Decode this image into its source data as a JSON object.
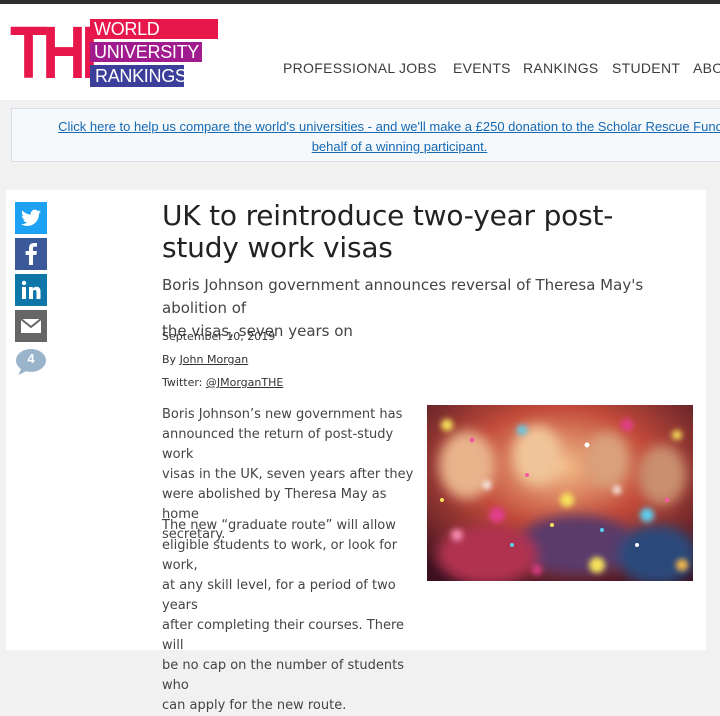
{
  "logo": {
    "the": "THE",
    "line1": "WORLD",
    "line2": "UNIVERSITY",
    "line3": "RANKINGS"
  },
  "nav": {
    "items": [
      "PROFESSIONAL",
      "JOBS",
      "EVENTS",
      "RANKINGS",
      "STUDENT",
      "ABO"
    ]
  },
  "promo": {
    "line1": "Click here to help us compare the world's universities - and we'll make a £250 donation to the Scholar Rescue Fund on",
    "line2": "behalf of a winning participant."
  },
  "share": {
    "icons": [
      "twitter-icon",
      "facebook-icon",
      "linkedin-icon",
      "email-icon"
    ],
    "comment_count": "4"
  },
  "article": {
    "title_line1": "UK to reintroduce two-year post-",
    "title_line2": "study work visas",
    "subtitle_line1": "Boris Johnson government announces reversal of Theresa May's abolition of",
    "subtitle_line2": "the visas, seven years on",
    "date": "September 10, 2019",
    "by_label": "By",
    "author": "John Morgan",
    "twitter_label": "Twitter:",
    "twitter_handle": "@JMorganTHE",
    "para1": [
      "Boris Johnson’s new government has",
      "announced the return of post-study work",
      "visas in the UK, seven years after they",
      "were abolished by Theresa May as home",
      "secretary."
    ],
    "para2": [
      "The new “graduate route” will allow",
      "eligible students to work, or look for work,",
      "at any skill level, for a period of two years",
      "after completing their courses. There will",
      "be no cap on the number of students who",
      "can apply for the new route."
    ]
  },
  "colors": {
    "brand_pink": "#e7174b",
    "brand_purple": "#a01b8e",
    "brand_blue": "#3b3f9a",
    "link": "#1669b3",
    "twitter": "#1da1f2",
    "facebook": "#3b5998",
    "linkedin": "#0e76a8",
    "email": "#666666",
    "comment": "#9ab4cc"
  }
}
